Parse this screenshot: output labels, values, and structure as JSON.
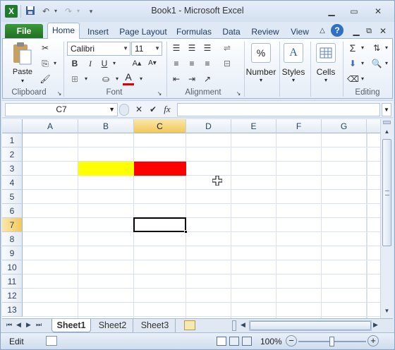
{
  "window": {
    "title": "Book1 - Microsoft Excel"
  },
  "tabs": [
    "File",
    "Home",
    "Insert",
    "Page Layout",
    "Formulas",
    "Data",
    "Review",
    "View"
  ],
  "ribbon": {
    "clipboard": {
      "paste": "Paste",
      "label": "Clipboard"
    },
    "font": {
      "name": "Calibri",
      "size": "11",
      "label": "Font",
      "bold": "B",
      "italic": "I",
      "underline": "U",
      "fontcolor_glyph": "A"
    },
    "alignment": {
      "label": "Alignment"
    },
    "number": {
      "label": "Number",
      "glyph": "%"
    },
    "styles": {
      "label": "Styles",
      "glyph": "A"
    },
    "cells": {
      "label": "Cells"
    },
    "editing": {
      "label": "Editing",
      "sum_glyph": "Σ"
    }
  },
  "formula_bar": {
    "name_box": "C7",
    "fx": "fx",
    "value": ""
  },
  "grid": {
    "columns": [
      "A",
      "B",
      "C",
      "D",
      "E",
      "F",
      "G"
    ],
    "rows": [
      "1",
      "2",
      "3",
      "4",
      "5",
      "6",
      "7",
      "8",
      "9",
      "10",
      "11",
      "12",
      "13"
    ],
    "selected_col": "C",
    "selected_row": "7",
    "fills": [
      {
        "cell": "B3",
        "color": "#ffff00"
      },
      {
        "cell": "C3",
        "color": "#ff0000"
      }
    ]
  },
  "sheets": [
    "Sheet1",
    "Sheet2",
    "Sheet3"
  ],
  "active_sheet": "Sheet1",
  "status": {
    "mode": "Edit",
    "zoom": "100%"
  },
  "colors": {
    "file_tab": "#2a7d2a",
    "fill_yellow": "#ffff00",
    "fill_red": "#ff0000"
  }
}
